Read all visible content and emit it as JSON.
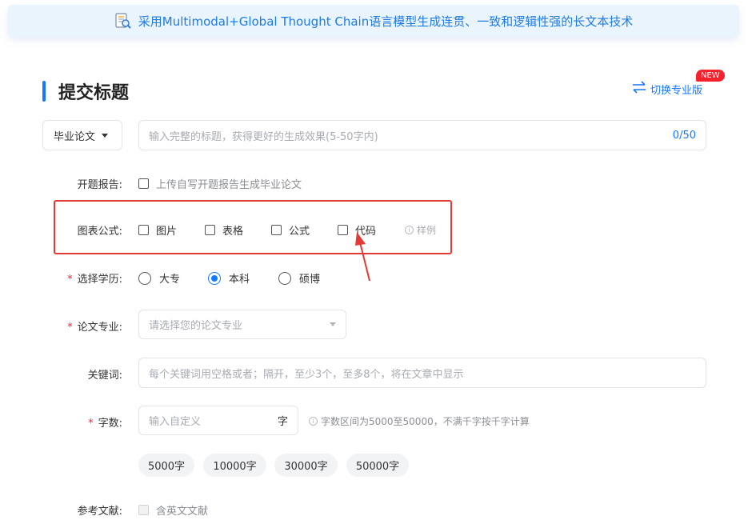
{
  "banner": {
    "text": "采用Multimodal+Global Thought Chain语言模型生成连贯、一致和逻辑性强的长文本技术",
    "icon": "document-search-icon"
  },
  "header": {
    "title": "提交标题",
    "switch_label": "切换专业版",
    "new_badge": "NEW"
  },
  "type_select": {
    "value": "毕业论文"
  },
  "title_input": {
    "placeholder": "输入完整的标题，获得更好的生成效果(5-50字内)",
    "counter": "0/50"
  },
  "proposal": {
    "label": "开题报告:",
    "option": "上传自写开题报告生成毕业论文"
  },
  "figures": {
    "label": "图表公式:",
    "options": [
      "图片",
      "表格",
      "公式",
      "代码"
    ],
    "example": "样例"
  },
  "education": {
    "label": "选择学历:",
    "options": [
      "大专",
      "本科",
      "硕博"
    ],
    "selected": "本科"
  },
  "major": {
    "label": "论文专业:",
    "placeholder": "请选择您的论文专业"
  },
  "keywords": {
    "label": "关键词:",
    "placeholder": "每个关键词用空格或者；隔开，至少3个，至多8个，将在文章中显示"
  },
  "word_count": {
    "label": "字数:",
    "placeholder": "输入自定义",
    "unit": "字",
    "hint": "字数区间为5000至50000，不满千字按千字计算",
    "presets": [
      "5000字",
      "10000字",
      "30000字",
      "50000字"
    ]
  },
  "references": {
    "label": "参考文献:",
    "option": "含英文文献"
  },
  "colors": {
    "accent": "#1677ff",
    "annotation": "#e53935",
    "required": "#f5222d"
  }
}
